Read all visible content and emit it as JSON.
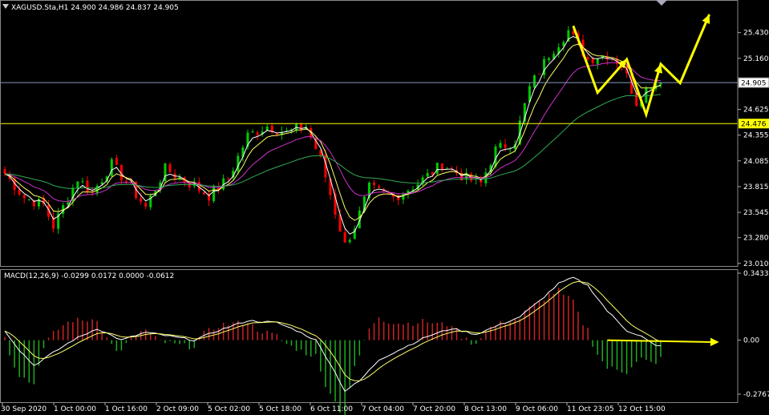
{
  "header": {
    "symbol_line": "XAGUSD.Sta,H1  24.900 24.986 24.837 24.905",
    "macd_line": "MACD(12,26,9) -0.0299 0.0172 0.0000 -0.0612"
  },
  "colors": {
    "background": "#000000",
    "bull_candle": "#00cc00",
    "bear_candle": "#ff0000",
    "ma_fast": "#ffffff",
    "ma_mid": "#ffff66",
    "ma_slow": "#cc33cc",
    "ma_long": "#33aa55",
    "support_line": "#ffff00",
    "price_line": "#8899bb",
    "arrows": "#ffff00",
    "macd_hist_pos": "#cc2222",
    "macd_hist_neg": "#22aa22"
  },
  "icons": {
    "scroll_marker": "triangle-down-icon"
  },
  "chart_data": [
    {
      "type": "candlestick",
      "series_name": "XAGUSD.Sta,H1",
      "ylim": [
        23.0,
        25.62
      ],
      "y_ticks": [
        "25.430",
        "25.160",
        "24.625",
        "24.355",
        "24.085",
        "23.815",
        "23.545",
        "23.280",
        "23.010"
      ],
      "price_label": "24.905",
      "current_price": 24.905,
      "level_line": 24.476,
      "level_label": "24.476",
      "x_labels": [
        "30 Sep 2020",
        "1 Oct 00:00",
        "1 Oct 16:00",
        "2 Oct 09:00",
        "5 Oct 02:00",
        "5 Oct 18:00",
        "6 Oct 11:00",
        "7 Oct 04:00",
        "7 Oct 20:00",
        "8 Oct 13:00",
        "9 Oct 06:00",
        "11 Oct 23:05",
        "12 Oct 15:00"
      ],
      "bars": 136,
      "price_path": [
        [
          0,
          23.95
        ],
        [
          4,
          23.7
        ],
        [
          8,
          23.62
        ],
        [
          10,
          23.4
        ],
        [
          12,
          23.6
        ],
        [
          15,
          23.9
        ],
        [
          18,
          23.75
        ],
        [
          22,
          24.05
        ],
        [
          26,
          23.8
        ],
        [
          29,
          23.6
        ],
        [
          33,
          24.0
        ],
        [
          38,
          23.85
        ],
        [
          42,
          23.72
        ],
        [
          46,
          23.9
        ],
        [
          50,
          24.35
        ],
        [
          54,
          24.45
        ],
        [
          58,
          24.38
        ],
        [
          62,
          24.45
        ],
        [
          65,
          24.1
        ],
        [
          68,
          23.55
        ],
        [
          70,
          23.2
        ],
        [
          72,
          23.4
        ],
        [
          75,
          23.8
        ],
        [
          80,
          23.7
        ],
        [
          85,
          23.85
        ],
        [
          90,
          24.05
        ],
        [
          95,
          23.9
        ],
        [
          98,
          23.85
        ],
        [
          101,
          24.2
        ],
        [
          105,
          24.3
        ],
        [
          108,
          24.85
        ],
        [
          112,
          25.2
        ],
        [
          116,
          25.45
        ],
        [
          120,
          25.15
        ],
        [
          124,
          25.2
        ],
        [
          127,
          25.1
        ],
        [
          130,
          24.7
        ],
        [
          133,
          24.9
        ],
        [
          135,
          24.905
        ]
      ],
      "overlays": [
        {
          "name": "ma_fast",
          "smoothing": 3
        },
        {
          "name": "ma_mid",
          "smoothing": 6
        },
        {
          "name": "ma_slow",
          "smoothing": 14
        },
        {
          "name": "ma_long",
          "smoothing": 40
        }
      ],
      "annotation_arrows_price": [
        [
          117,
          25.5
        ],
        [
          122,
          24.8
        ],
        [
          128,
          25.15
        ],
        [
          132,
          24.57
        ],
        [
          135,
          25.1
        ],
        [
          139,
          24.9
        ],
        [
          145,
          25.62
        ]
      ]
    },
    {
      "type": "histogram",
      "series_name": "MACD(12,26,9)",
      "ylim": [
        -0.2767,
        0.3433
      ],
      "y_ticks": [
        "0.3433",
        "0.00",
        "-0.2767"
      ],
      "macd_path": [
        [
          0,
          0.05
        ],
        [
          3,
          -0.05
        ],
        [
          6,
          -0.13
        ],
        [
          9,
          -0.08
        ],
        [
          14,
          0.0
        ],
        [
          19,
          0.06
        ],
        [
          24,
          0.0
        ],
        [
          29,
          0.04
        ],
        [
          34,
          0.02
        ],
        [
          39,
          0.0
        ],
        [
          44,
          0.05
        ],
        [
          50,
          0.1
        ],
        [
          56,
          0.09
        ],
        [
          60,
          0.05
        ],
        [
          64,
          0.0
        ],
        [
          67,
          -0.12
        ],
        [
          70,
          -0.26
        ],
        [
          73,
          -0.21
        ],
        [
          77,
          -0.1
        ],
        [
          82,
          -0.04
        ],
        [
          87,
          0.02
        ],
        [
          92,
          0.06
        ],
        [
          97,
          0.03
        ],
        [
          102,
          0.08
        ],
        [
          106,
          0.12
        ],
        [
          110,
          0.2
        ],
        [
          114,
          0.29
        ],
        [
          117,
          0.32
        ],
        [
          120,
          0.28
        ],
        [
          124,
          0.15
        ],
        [
          128,
          0.05
        ],
        [
          131,
          0.02
        ],
        [
          134,
          -0.03
        ]
      ],
      "signal_smoothing": 5,
      "histogram_scale": 0.6,
      "annotation_arrow_value": [
        [
          124,
          0.0
        ],
        [
          147,
          -0.01
        ]
      ]
    }
  ]
}
